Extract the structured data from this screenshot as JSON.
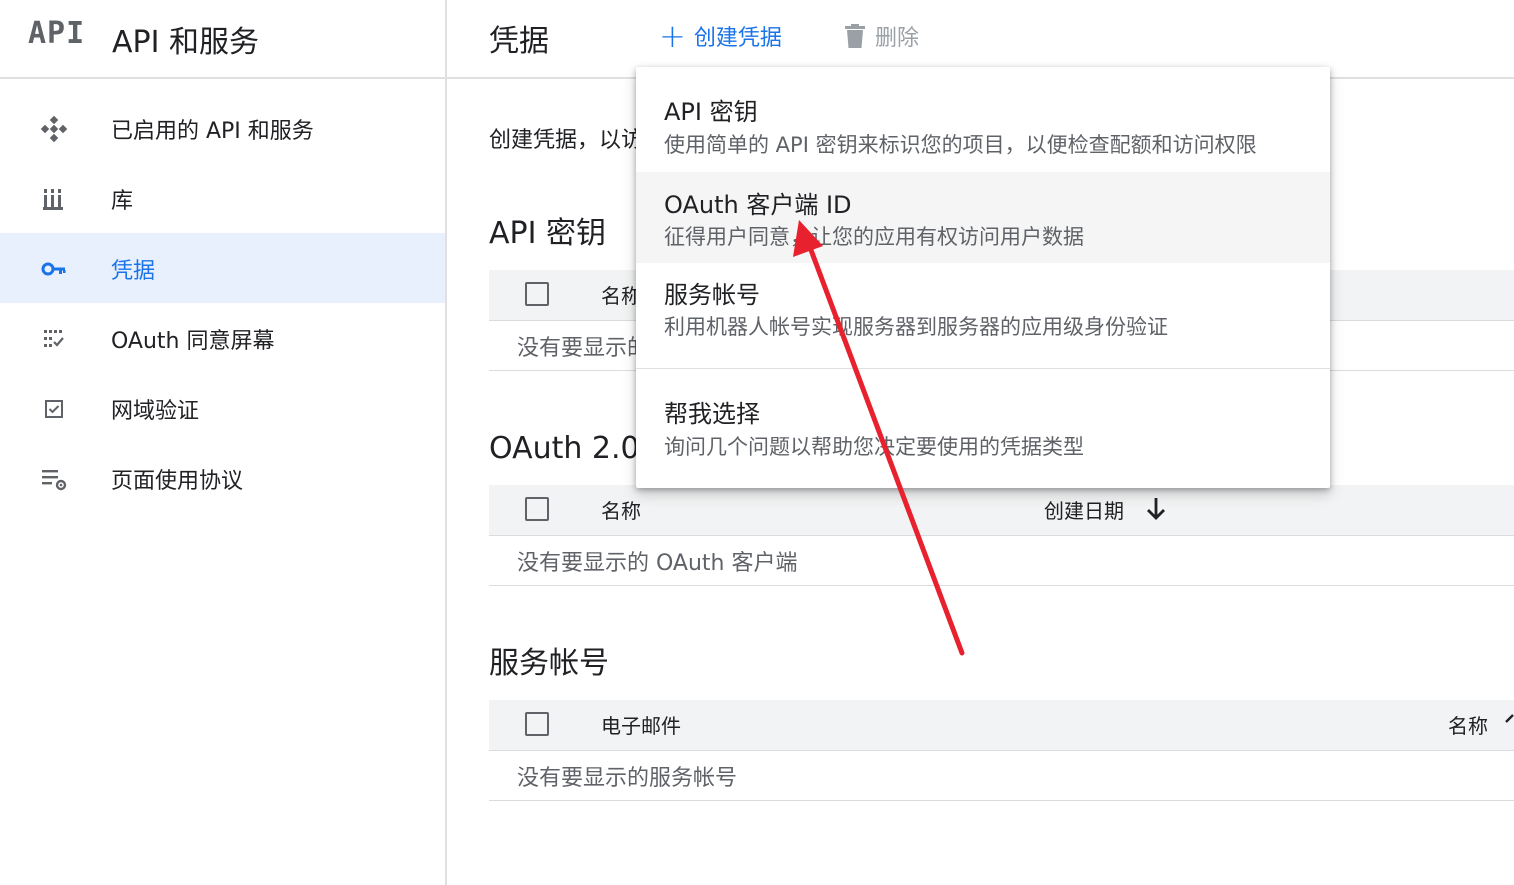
{
  "sidebar": {
    "brand_logo": "API",
    "brand_title": "API 和服务",
    "items": [
      {
        "label": "已启用的 API 和服务",
        "icon": "api-diamond-icon"
      },
      {
        "label": "库",
        "icon": "library-icon"
      },
      {
        "label": "凭据",
        "icon": "key-icon",
        "active": true
      },
      {
        "label": "OAuth 同意屏幕",
        "icon": "consent-icon"
      },
      {
        "label": "网域验证",
        "icon": "checkbox-verify-icon"
      },
      {
        "label": "页面使用协议",
        "icon": "settings-list-icon"
      }
    ]
  },
  "toolbar": {
    "title": "凭据",
    "create_icon": "+",
    "create_label": "创建凭据",
    "delete_label": "删除"
  },
  "main": {
    "intro": "创建凭据，以访",
    "api_keys": {
      "title": "API 密钥",
      "col_name": "名称",
      "empty": "没有要显示的"
    },
    "oauth": {
      "title": "OAuth 2.0 客",
      "col_name": "名称",
      "col_date": "创建日期",
      "empty": "没有要显示的 OAuth 客户端"
    },
    "service_accounts": {
      "title": "服务帐号",
      "col_email": "电子邮件",
      "col_name": "名称",
      "empty": "没有要显示的服务帐号"
    }
  },
  "menu": {
    "items": [
      {
        "title": "API 密钥",
        "desc": "使用简单的 API 密钥来标识您的项目，以便检查配额和访问权限"
      },
      {
        "title": "OAuth 客户端 ID",
        "desc": "征得用户同意，让您的应用有权访问用户数据"
      },
      {
        "title": "服务帐号",
        "desc": "利用机器人帐号实现服务器到服务器的应用级身份验证"
      },
      {
        "title": "帮我选择",
        "desc": "询问几个问题以帮助您决定要使用的凭据类型"
      }
    ]
  },
  "colors": {
    "accent": "#1a73e8",
    "active_bg": "#e8f0fe",
    "annotation_arrow": "#e8212e"
  }
}
